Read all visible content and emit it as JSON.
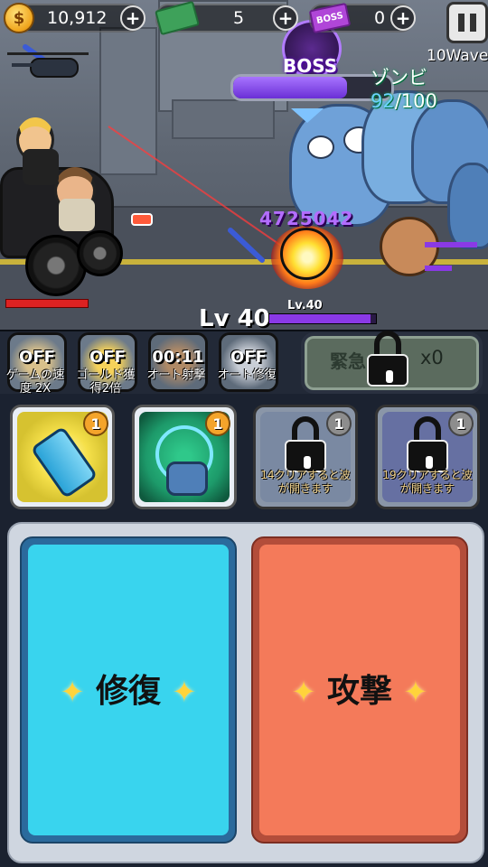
{
  "hud": {
    "coins": "10,912",
    "cash": "5",
    "tickets": "0",
    "coin_symbol": "$",
    "ticket_label": "BOSS",
    "plus": "+"
  },
  "boss": {
    "label": "BOSS",
    "hp_fraction": 0.72,
    "wave": "10Wave",
    "zombie_name": "ゾンビ",
    "zombie_current": "92",
    "zombie_total": "/100"
  },
  "battle": {
    "damage_text": "4725042",
    "player_level": "Lv 40",
    "enemy_level": "Lv.40",
    "xp_fraction": 0.95
  },
  "skills": [
    {
      "value": "OFF",
      "label": "ゲームの速度 2X",
      "icon": "speed-icon"
    },
    {
      "value": "OFF",
      "label": "ゴールド獲得2倍",
      "icon": "gold-icon"
    },
    {
      "value": "00:11",
      "label": "オート射撃",
      "icon": "auto-fire-icon"
    },
    {
      "value": "OFF",
      "label": "オート修復",
      "icon": "wrench-icon"
    }
  ],
  "emergency": {
    "label": "緊急",
    "count": "x0"
  },
  "items": [
    {
      "count": "1",
      "icon": "battery-icon",
      "locked": false
    },
    {
      "count": "1",
      "icon": "zombie-target-icon",
      "locked": false
    },
    {
      "count": "1",
      "icon": "locked-item-icon",
      "locked": true,
      "lock_text": "14クリアすると波が開きます"
    },
    {
      "count": "1",
      "icon": "locked-item-icon",
      "locked": true,
      "lock_text": "19クリアすると波が開きます"
    }
  ],
  "actions": {
    "repair": "修復",
    "attack": "攻撃",
    "sparkle": "✦"
  },
  "colors": {
    "repair": "#39d4ee",
    "attack": "#f47a5a",
    "accent": "#8a39e6"
  }
}
